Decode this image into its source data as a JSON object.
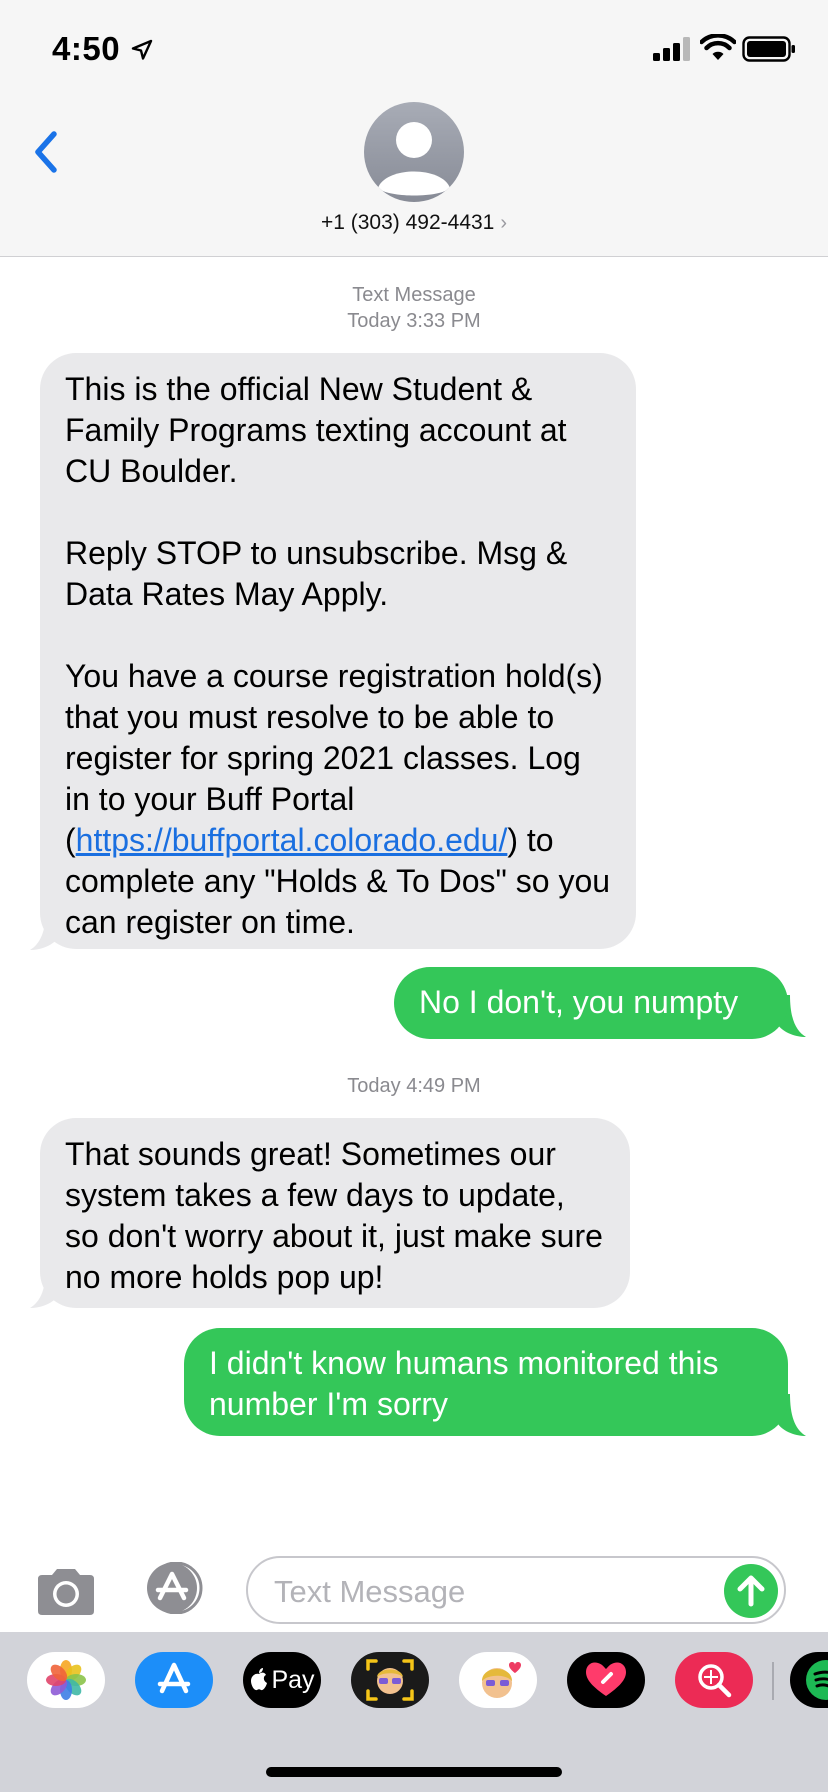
{
  "status_bar": {
    "time": "4:50"
  },
  "header": {
    "contact_number": "+1 (303) 492-4431",
    "chevron": "›"
  },
  "messages": {
    "stamp1_line1": "Text Message",
    "stamp1_line2": "Today 3:33 PM",
    "m1_p1": "This is the official New Student & Family Programs texting account at CU Boulder.",
    "m1_p2": "Reply STOP to unsubscribe. Msg & Data Rates May Apply.",
    "m1_p3_a": "You have a course registration hold(s) that you must resolve to be able to register for spring 2021 classes. Log in to your Buff Portal (",
    "m1_link": "https://buffportal.colorado.edu/",
    "m1_p3_b": ") to complete any \"Holds & To Dos\" so you can register on time.",
    "m2": "No I don't, you numpty",
    "stamp2": "Today 4:49 PM",
    "m3": "That sounds great! Sometimes our system takes a few days to update, so don't worry about it, just make sure no more holds pop up!",
    "m4": "I didn't know humans monitored this number I'm sorry"
  },
  "input": {
    "placeholder": "Text Message"
  },
  "app_drawer": {
    "apple_pay_label": "Pay",
    "apps": [
      "photos-icon",
      "app-store-icon",
      "apple-pay-icon",
      "memoji-camera-icon",
      "memoji-stickers-icon",
      "digital-touch-icon",
      "images-search-icon",
      "spotify-icon"
    ]
  },
  "colors": {
    "incoming": "#e9e9eb",
    "outgoing": "#34c759",
    "accent": "#1a73e8",
    "link": "#1a6fe0"
  }
}
